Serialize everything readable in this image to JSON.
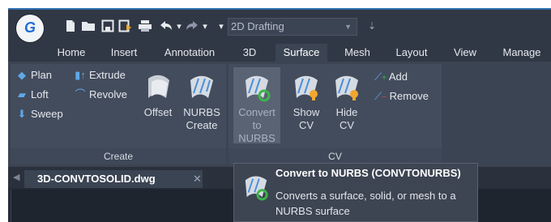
{
  "app": {
    "logo_letter": "G",
    "workspace": "2D Drafting"
  },
  "quick_access": {
    "icons": [
      "new-file-icon",
      "open-folder-icon",
      "save-icon",
      "save-as-icon",
      "print-icon",
      "undo-icon",
      "redo-icon"
    ]
  },
  "ribbon_tabs": [
    {
      "label": "Home"
    },
    {
      "label": "Insert"
    },
    {
      "label": "Annotation"
    },
    {
      "label": "3D"
    },
    {
      "label": "Surface",
      "active": true
    },
    {
      "label": "Mesh"
    },
    {
      "label": "Layout"
    },
    {
      "label": "View"
    },
    {
      "label": "Manage"
    }
  ],
  "create_panel": {
    "title": "Create",
    "small": [
      {
        "label": "Plan",
        "icon": "plan-surface-icon"
      },
      {
        "label": "Loft",
        "icon": "loft-icon"
      },
      {
        "label": "Sweep",
        "icon": "sweep-icon"
      },
      {
        "label": "Extrude",
        "icon": "extrude-icon"
      },
      {
        "label": "Revolve",
        "icon": "revolve-icon"
      }
    ],
    "offset": "Offset",
    "nurbs_line1": "NURBS",
    "nurbs_line2": "Create"
  },
  "cv_panel": {
    "title": "CV",
    "convert_line1": "Convert",
    "convert_line2": "to NURBS",
    "show_line1": "Show",
    "show_line2": "CV",
    "hide_line1": "Hide",
    "hide_line2": "CV",
    "add": "Add",
    "remove": "Remove"
  },
  "document": {
    "tab_name": "3D-CONVTOSOLID.dwg",
    "close": "✕"
  },
  "tooltip": {
    "title": "Convert to NURBS (CONVTONURBS)",
    "description": "Converts a surface, solid, or mesh to a NURBS surface"
  },
  "colors": {
    "ribbon_bg": "#3b4453",
    "panel_bg": "#434c5c",
    "accent_blue": "#1f6ed4"
  }
}
